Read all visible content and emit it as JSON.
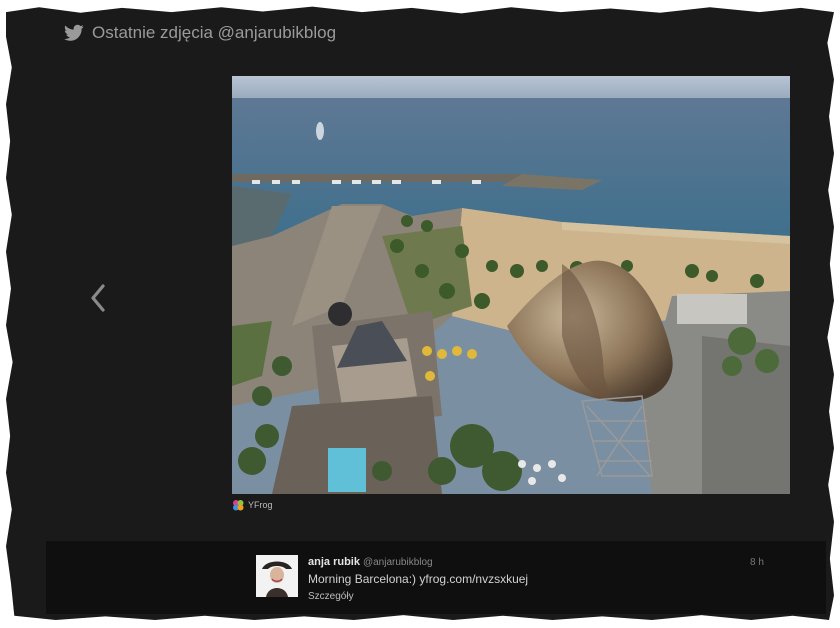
{
  "header": {
    "title": "Ostatnie zdjęcia @anjarubikblog",
    "icon": "twitter-bird-icon"
  },
  "navigation": {
    "prev_icon": "chevron-left-icon"
  },
  "photo": {
    "provider_label": "YFrog",
    "provider_icon": "yfrog-logo-icon"
  },
  "tweet": {
    "author_name": "anja rubik",
    "author_handle": "@anjarubikblog",
    "text": "Morning Barcelona:) yfrog.com/nvzsxkuej",
    "details_link": "Szczegóły",
    "time": "8 h"
  },
  "colors": {
    "frame_background": "#1a1a1a",
    "tweet_background": "#0f0f0f",
    "header_text": "#9a9a9a"
  }
}
